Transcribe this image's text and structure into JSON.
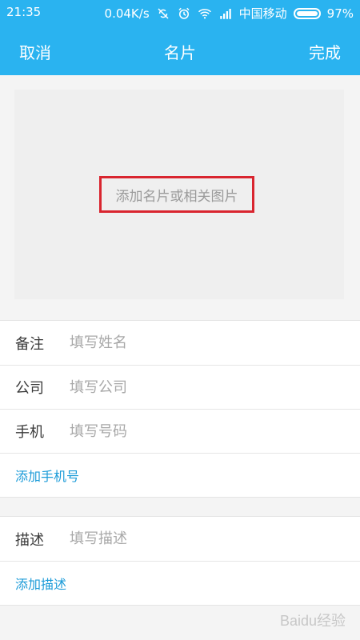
{
  "status_bar": {
    "time": "21:35",
    "network_speed": "0.04K/s",
    "carrier": "中国移动",
    "battery": "97%",
    "icons": [
      "sync-off-icon",
      "alarm-icon",
      "wifi-icon",
      "signal-icon",
      "battery-icon"
    ]
  },
  "header": {
    "cancel_label": "取消",
    "title": "名片",
    "done_label": "完成",
    "background": "#2ab3f0"
  },
  "image_area": {
    "add_label": "添加名片或相关图片",
    "highlight_color": "#d9252f"
  },
  "form": {
    "name": {
      "label": "备注",
      "placeholder": "填写姓名",
      "value": ""
    },
    "company": {
      "label": "公司",
      "placeholder": "填写公司",
      "value": ""
    },
    "phone": {
      "label": "手机",
      "placeholder": "填写号码",
      "value": ""
    },
    "add_phone_label": "添加手机号",
    "description": {
      "label": "描述",
      "placeholder": "填写描述",
      "value": ""
    },
    "add_description_label": "添加描述",
    "link_color": "#1c9bd8"
  },
  "watermark": {
    "text": "Baidu经验"
  }
}
